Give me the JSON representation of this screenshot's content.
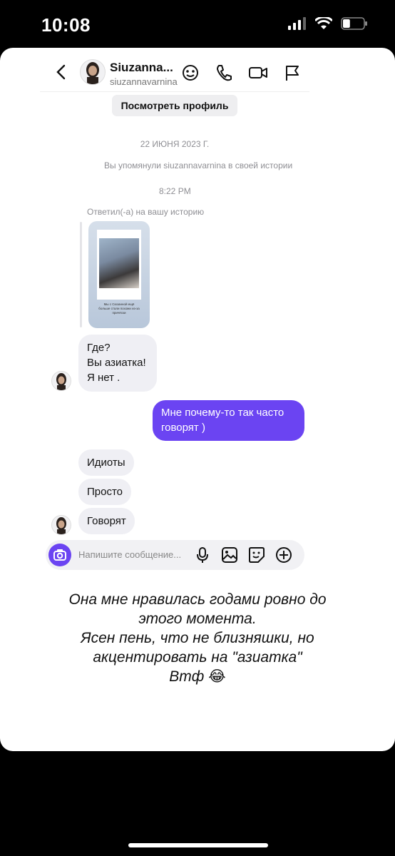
{
  "status_bar": {
    "time": "10:08",
    "battery_level": 0.35
  },
  "header": {
    "display_name": "Siuzanna...",
    "username": "siuzannavarnina",
    "view_profile_label": "Посмотреть профиль"
  },
  "conversation": {
    "date": "22 ИЮНЯ 2023 Г.",
    "mention_note": "Вы упомянули siuzannavarnina в своей истории",
    "time": "8:22 PM",
    "reply_label": "Ответил(-а) на вашу историю",
    "story_caption": "Мы с Сюзанной ещё больше стали похожи из-за причёски",
    "messages": [
      {
        "from": "them",
        "lines": [
          "Где?",
          "Вы азиатка!",
          "Я нет ."
        ]
      },
      {
        "from": "me",
        "lines": [
          "Мне почему-то так часто",
          "говорят )"
        ]
      },
      {
        "from": "them",
        "lines": [
          "Идиоты"
        ]
      },
      {
        "from": "them",
        "lines": [
          "Просто"
        ]
      },
      {
        "from": "them",
        "lines": [
          "Говорят"
        ]
      }
    ]
  },
  "composer": {
    "placeholder": "Напишите сообщение..."
  },
  "caption": {
    "lines": [
      "Она мне нравилась годами ровно до",
      "этого момента.",
      "Ясен пень, что не близняшки, но",
      "акцентировать на \"азиатка\"",
      "Втф 😂"
    ]
  },
  "colors": {
    "accent": "#6b44f2",
    "incoming_bubble": "#efeff4"
  },
  "icons": [
    "back-icon",
    "sticker-icon",
    "phone-icon",
    "video-icon",
    "flag-icon",
    "camera-icon",
    "mic-icon",
    "image-icon",
    "sticker-icon",
    "plus-circle-icon"
  ]
}
